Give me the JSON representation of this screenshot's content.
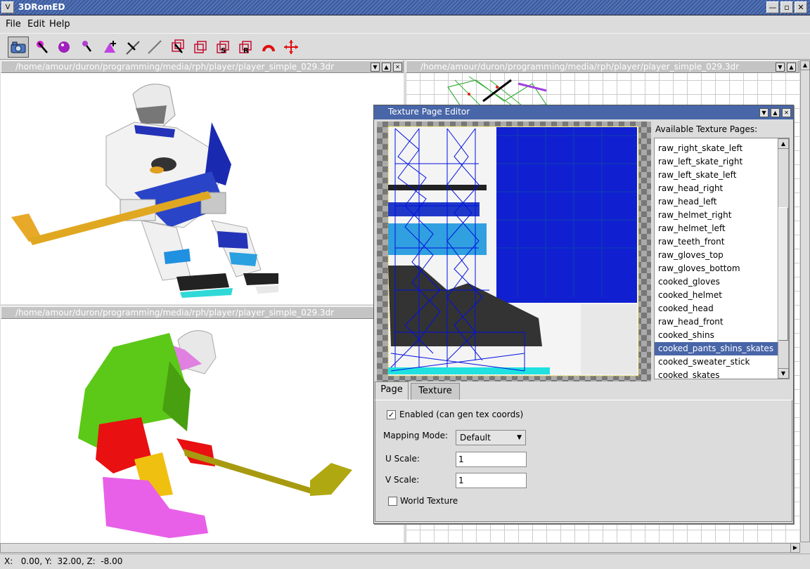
{
  "window": {
    "title": "3DRomED",
    "system_glyph": "V",
    "minimize": "—",
    "maximize": "▫",
    "close": "✕"
  },
  "menu": {
    "file": "File",
    "edit": "Edit",
    "help": "Help"
  },
  "toolbar": {
    "icons": [
      "camera-icon",
      "select-vertex-icon",
      "select-sphere-icon",
      "select-arrow-icon",
      "add-vertex-icon",
      "select-line-icon",
      "line-icon",
      "select-box-icon",
      "box-icon",
      "scale-box-icon",
      "rotate-box-icon",
      "undo-arc-icon",
      "move-icon"
    ]
  },
  "viewports": {
    "top_left": {
      "path": "/home/amour/duron/programming/media/rph/player/player_simple_029.3dr"
    },
    "top_right": {
      "path": "/home/amour/duron/programming/media/rph/player/player_simple_029.3dr"
    },
    "bottom_left": {
      "path": "/home/amour/duron/programming/media/rph/player/player_simple_029.3dr"
    }
  },
  "dialog": {
    "title": "Texture Page Editor",
    "list_label": "Available Texture Pages:",
    "items": [
      "raw_right_skate_left",
      "raw_left_skate_right",
      "raw_left_skate_left",
      "raw_head_right",
      "raw_head_left",
      "raw_helmet_right",
      "raw_helmet_left",
      "raw_teeth_front",
      "raw_gloves_top",
      "raw_gloves_bottom",
      "cooked_gloves",
      "cooked_helmet",
      "cooked_head",
      "raw_head_front",
      "cooked_shins",
      "cooked_pants_shins_skates",
      "cooked_sweater_stick",
      "cooked_skates"
    ],
    "selected_item": "cooked_pants_shins_skates",
    "tabs": {
      "page": "Page",
      "texture": "Texture"
    },
    "enabled_label": "Enabled (can gen tex coords)",
    "enabled_mark": "✓",
    "mapping_label": "Mapping Mode:",
    "mapping_value": "Default",
    "u_label": "U Scale:",
    "u_value": "1",
    "v_label": "V Scale:",
    "v_value": "1",
    "world_label": "World Texture",
    "colors": {
      "selection": "#4866a8",
      "title": "#4866a8"
    }
  },
  "status": {
    "text": "X:   0.00, Y:  32.00, Z:  -8.00"
  }
}
